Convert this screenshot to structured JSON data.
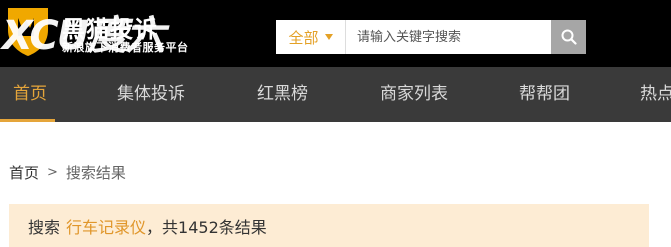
{
  "logo": {
    "title": "黑猫投诉",
    "subtitle": "新浪旗下消费者服务平台",
    "overlay": "XCU度六"
  },
  "search": {
    "scope_label": "全部",
    "placeholder": "请输入关键字搜索",
    "value": "",
    "button_icon": "search-icon"
  },
  "nav": {
    "items": [
      {
        "label": "首页",
        "active": true
      },
      {
        "label": "集体投诉",
        "active": false
      },
      {
        "label": "红黑榜",
        "active": false
      },
      {
        "label": "商家列表",
        "active": false
      },
      {
        "label": "帮帮团",
        "active": false
      },
      {
        "label": "热点",
        "active": false
      }
    ]
  },
  "breadcrumb": {
    "home": "首页",
    "separator": ">",
    "current": "搜索结果"
  },
  "result": {
    "prefix": "搜索",
    "keyword": "行车记录仪",
    "suffix": "，共1452条结果"
  },
  "colors": {
    "accent": "#e5a53a",
    "nav_bg": "#3a3a3a",
    "header_bg": "#000000",
    "result_bg": "#fdecd4"
  }
}
